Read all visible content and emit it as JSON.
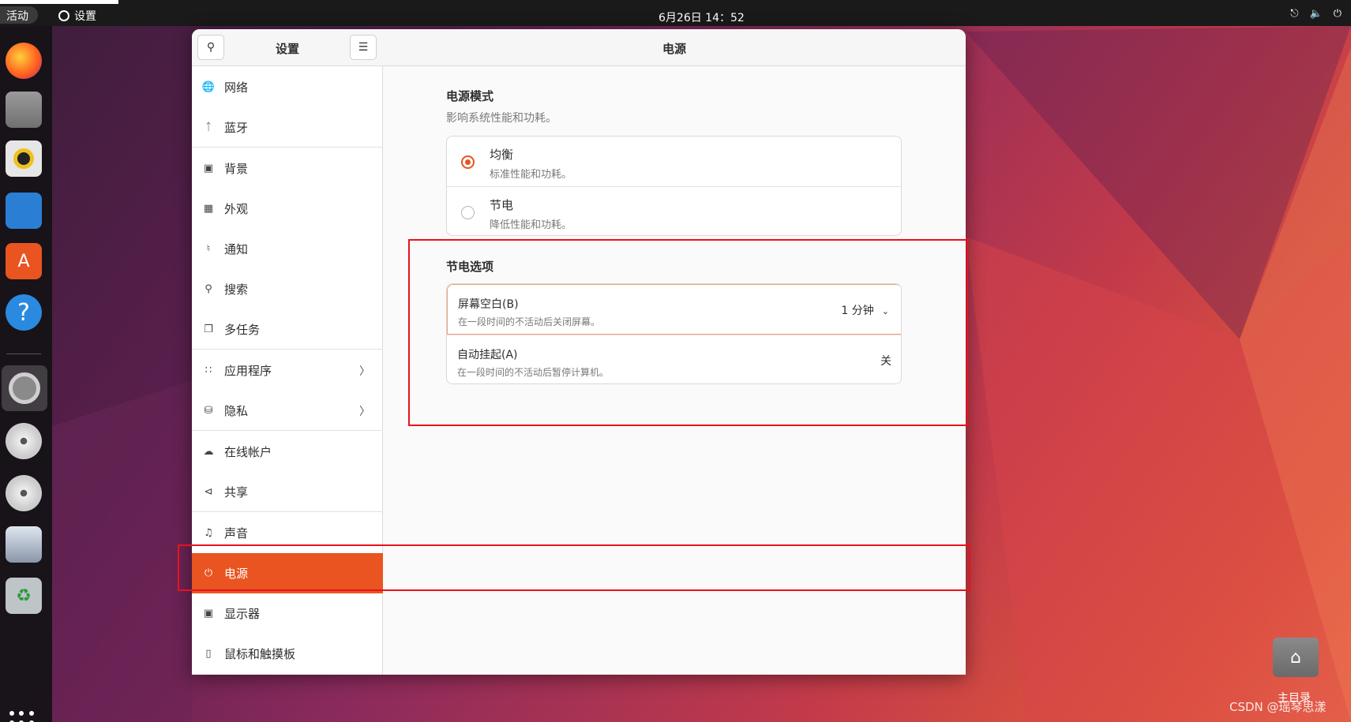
{
  "topbar": {
    "activities": "活动",
    "app_name": "设置",
    "clock": "6月26日  14：52"
  },
  "dock": {
    "items": [
      {
        "name": "firefox-icon"
      },
      {
        "name": "files-icon"
      },
      {
        "name": "rhythmbox-icon"
      },
      {
        "name": "libreoffice-writer-icon"
      },
      {
        "name": "app-center-icon"
      },
      {
        "name": "help-icon"
      },
      {
        "name": "settings-icon"
      },
      {
        "name": "disc-icon"
      },
      {
        "name": "disc-icon-2"
      },
      {
        "name": "save-icon"
      },
      {
        "name": "trash-icon"
      }
    ]
  },
  "sidebar": {
    "title": "设置",
    "items": [
      {
        "label": "网络",
        "icon": "globe-icon"
      },
      {
        "label": "蓝牙",
        "icon": "bluetooth-icon"
      },
      {
        "label": "背景",
        "icon": "monitor-icon"
      },
      {
        "label": "外观",
        "icon": "appearance-icon"
      },
      {
        "label": "通知",
        "icon": "bell-icon"
      },
      {
        "label": "搜索",
        "icon": "search-icon"
      },
      {
        "label": "多任务",
        "icon": "multitask-icon"
      },
      {
        "label": "应用程序",
        "icon": "apps-grid-icon"
      },
      {
        "label": "隐私",
        "icon": "lock-icon"
      },
      {
        "label": "在线帐户",
        "icon": "cloud-icon"
      },
      {
        "label": "共享",
        "icon": "share-icon"
      },
      {
        "label": "声音",
        "icon": "music-icon"
      },
      {
        "label": "电源",
        "icon": "power-icon"
      },
      {
        "label": "显示器",
        "icon": "display-icon"
      },
      {
        "label": "鼠标和触摸板",
        "icon": "mouse-icon"
      }
    ],
    "selected": "电源"
  },
  "content": {
    "title": "电源",
    "power_mode": {
      "title": "电源模式",
      "subtitle": "影响系统性能和功耗。",
      "options": [
        {
          "label": "均衡",
          "desc": "标准性能和功耗。",
          "selected": true
        },
        {
          "label": "节电",
          "desc": "降低性能和功耗。",
          "selected": false
        }
      ]
    },
    "power_saving": {
      "title": "节电选项",
      "rows": [
        {
          "label": "屏幕空白(B)",
          "desc": "在一段时间的不活动后关闭屏幕。",
          "value": "1 分钟"
        },
        {
          "label": "自动挂起(A)",
          "desc": "在一段时间的不活动后暂停计算机。",
          "value": "关"
        }
      ]
    }
  },
  "desktop": {
    "home_label": "主目录"
  },
  "watermark": "CSDN @瑶琴思漾",
  "colors": {
    "accent": "#e95420",
    "annotation": "#e8121f"
  }
}
